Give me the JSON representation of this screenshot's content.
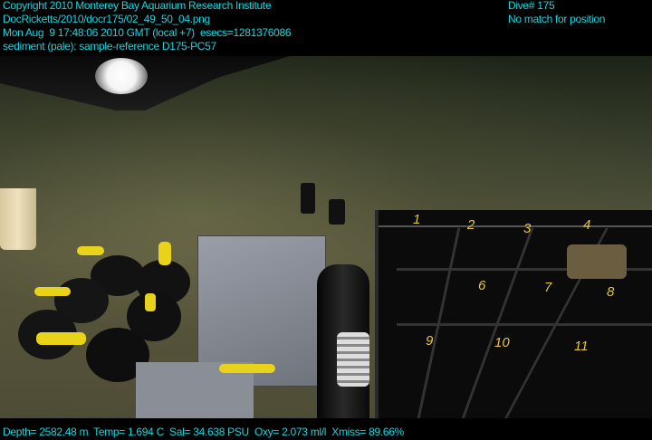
{
  "header": {
    "copyright": "Copyright 2010 Monterey Bay Aquarium Research Institute",
    "filename": "DocRicketts/2010/docr175/02_49_50_04.png",
    "timestamp": "Mon Aug  9 17:48:06 2010 GMT (local +7)  esecs=1281376086",
    "annotation": "sediment (pale): sample-reference D175-PC57",
    "dive": "Dive# 175",
    "position": "No match for position"
  },
  "footer": {
    "telemetry": "Depth= 2582.48 m  Temp= 1.694 C  Sal= 34.638 PSU  Oxy= 2.073 ml/l  Xmiss= 89.66%"
  },
  "crate_labels": [
    "1",
    "2",
    "3",
    "4",
    "6",
    "7",
    "8",
    "9",
    "10",
    "11"
  ],
  "colors": {
    "overlay_text": "#19d6df",
    "rope": "#e8d21a",
    "label": "#e6c63a"
  }
}
